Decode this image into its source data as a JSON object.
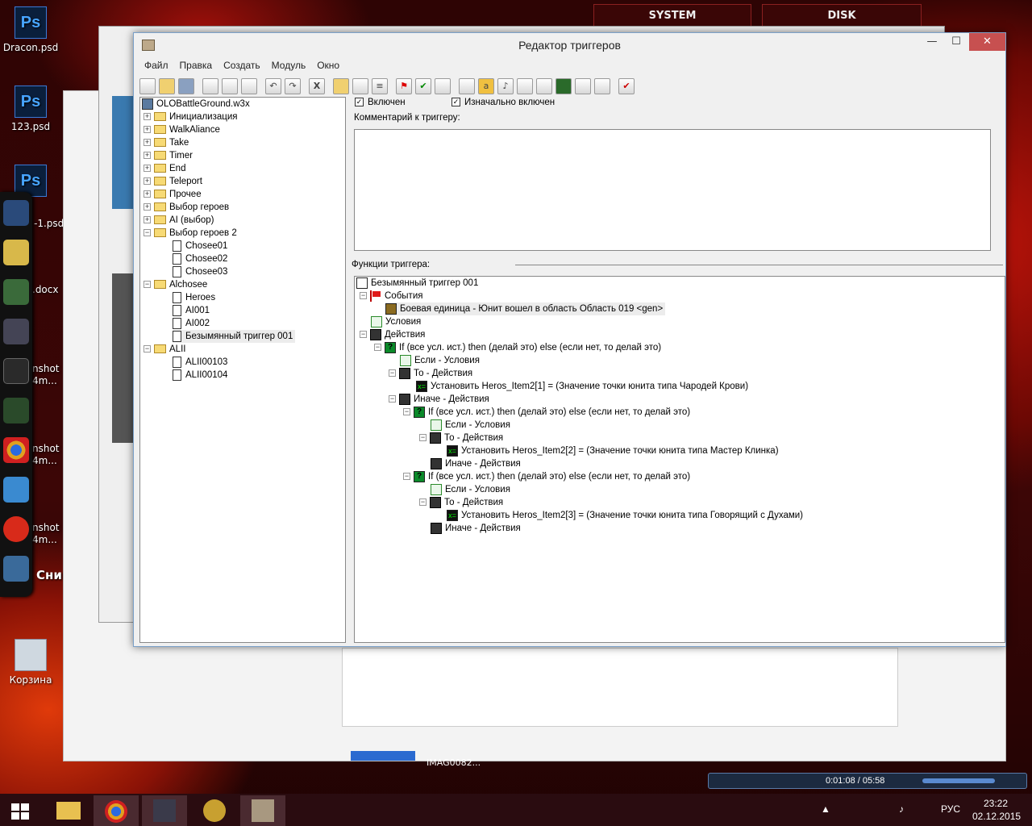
{
  "desktop": {
    "icons": [
      {
        "label": "Dracon.psd",
        "glyph": "Ps"
      },
      {
        "label": "123.psd",
        "glyph": "Ps"
      },
      {
        "label": "Ps",
        "glyph": "Ps"
      }
    ],
    "peek_labels": [
      "-1.psd",
      ".docx",
      "nshot",
      "4m...",
      "nshot",
      "4m...",
      "nshot",
      "4m..."
    ],
    "recycle": "Корзина",
    "tooltip": "Снимок экрана",
    "hud": {
      "system": "SYSTEM",
      "disk": "DISK"
    },
    "bg_item": "IMAG0082..."
  },
  "editor": {
    "title": "Редактор триггеров",
    "menu": [
      "Файл",
      "Правка",
      "Создать",
      "Модуль",
      "Окно"
    ],
    "window_buttons": {
      "minimize": "—",
      "maximize": "☐",
      "close": "✕"
    },
    "toolbar_icons": [
      "new-icon",
      "open-icon",
      "save-icon",
      "cut-icon",
      "copy-icon",
      "paste-icon",
      "undo-icon",
      "redo-icon",
      "delete-icon",
      "new-category-icon",
      "new-trigger-icon",
      "new-comment-icon",
      "new-event-icon",
      "new-condition-icon",
      "new-action-icon",
      "terrain-icon",
      "unit-icon",
      "sound-icon",
      "ai-icon",
      "object-icon",
      "import-icon",
      "test-map-icon",
      "campaign-icon",
      "close-editor-icon"
    ],
    "tree": {
      "root": "OLOBattleGround.w3x",
      "folders": [
        "Инициализация",
        "WalkAliance",
        "Take",
        "Timer",
        "End",
        "Teleport",
        "Прочее",
        "Выбор героев",
        "AI (выбор)"
      ],
      "open_folder": "Выбор героев 2",
      "open_items": [
        "Chosee01",
        "Chosee02",
        "Chosee03"
      ],
      "folder2": "Alchosee",
      "folder2_items": [
        "Heroes",
        "AI001",
        "AI002",
        "Безымянный триггер 001"
      ],
      "folder3": "ALII",
      "folder3_items": [
        "ALII00103",
        "ALII00104"
      ]
    },
    "enabled_label": "Включен",
    "initially_on_label": "Изначально включен",
    "comment_label": "Комментарий к триггеру:",
    "functions_label": "Функции триггера:",
    "functions": [
      "Безымянный триггер 001",
      "События",
      "Боевая единица - Юнит вошел в область Область 019 <gen>",
      "Условия",
      "Действия",
      "If (все усл. ист.) then (делай это) else (если нет, то делай это)",
      "Если - Условия",
      "То - Действия",
      "Установить Heros_Item2[1] = (Значение точки юнита типа Чародей Крови)",
      "Иначе - Действия",
      "If (все усл. ист.) then (делай это) else (если нет, то делай это)",
      "Если - Условия",
      "То - Действия",
      "Установить Heros_Item2[2] = (Значение точки юнита типа Мастер Клинка)",
      "Иначе - Действия",
      "If (все усл. ист.) then (делай это) else (если нет, то делай это)",
      "Если - Условия",
      "То - Действия",
      "Установить Heros_Item2[3] = (Значение точки юнита типа Говорящий с Духами)",
      "Иначе - Действия"
    ]
  },
  "taskbar": {
    "lang": "РУС",
    "time": "23:22",
    "date": "02.12.2015",
    "player_time": "0:01:08 / 05:58"
  },
  "colors": {
    "accent": "#c75050",
    "tree_folder": "#f7da75"
  }
}
